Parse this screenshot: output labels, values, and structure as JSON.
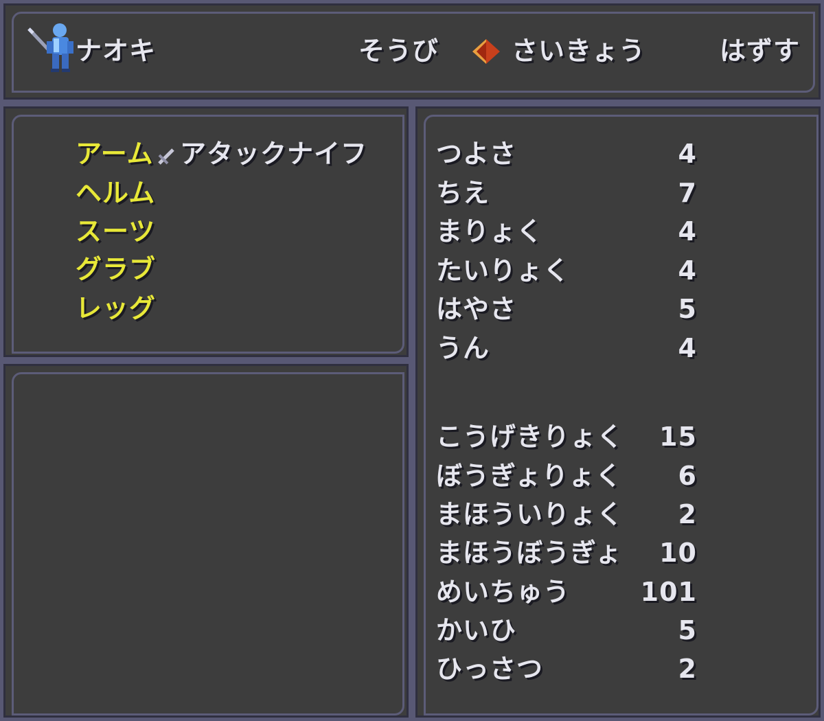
{
  "header": {
    "character_name": "ナオキ",
    "character_sprite": "swordsman-sprite-icon",
    "menu": [
      {
        "label": "そうび"
      },
      {
        "label": "さいきょう",
        "selected": true
      },
      {
        "label": "はずす"
      }
    ],
    "cursor_icon": "diamond-cursor-icon"
  },
  "equipment": {
    "slots": [
      {
        "label": "アーム",
        "item": "アタックナイフ",
        "item_icon": "knife-icon"
      },
      {
        "label": "ヘルム",
        "item": ""
      },
      {
        "label": "スーツ",
        "item": ""
      },
      {
        "label": "グラブ",
        "item": ""
      },
      {
        "label": "レッグ",
        "item": ""
      }
    ]
  },
  "stats": {
    "base": [
      {
        "label": "つよさ",
        "value": "4"
      },
      {
        "label": "ちえ",
        "value": "7"
      },
      {
        "label": "まりょく",
        "value": "4"
      },
      {
        "label": "たいりょく",
        "value": "4"
      },
      {
        "label": "はやさ",
        "value": "5"
      },
      {
        "label": "うん",
        "value": "4"
      }
    ],
    "derived": [
      {
        "label": "こうげきりょく",
        "value": "15"
      },
      {
        "label": "ぼうぎょりょく",
        "value": "6"
      },
      {
        "label": "まほういりょく",
        "value": "2"
      },
      {
        "label": "まほうぼうぎょ",
        "value": "10"
      },
      {
        "label": "めいちゅう",
        "value": "101"
      },
      {
        "label": "かいひ",
        "value": "5"
      },
      {
        "label": "ひっさつ",
        "value": "2"
      }
    ]
  },
  "colors": {
    "panel_bg": "#3d3d3d",
    "border": "#585874",
    "text": "#e6e6ee",
    "slot_label": "#e8e838",
    "cursor": "#c8401c"
  }
}
